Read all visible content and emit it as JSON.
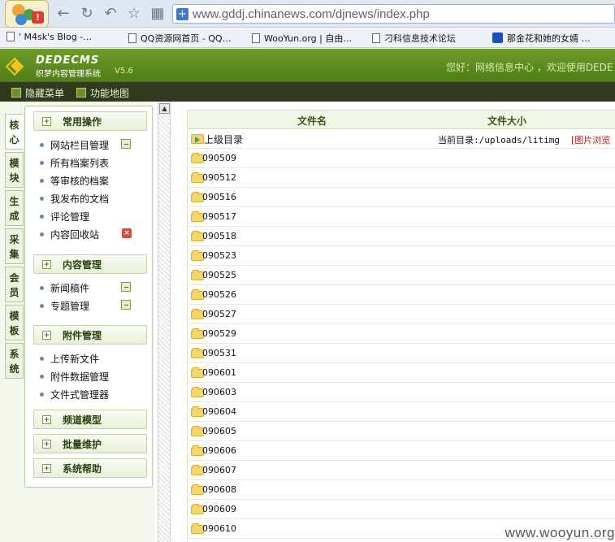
{
  "browser": {
    "url": "www.gddj.chinanews.com/djnews/index.php",
    "bookmarks": [
      {
        "label": "' M4sk's Blog -…"
      },
      {
        "label": "QQ资源网首页 - QQ…"
      },
      {
        "label": "WooYun.org | 自由…"
      },
      {
        "label": "刁科信息技术论坛"
      },
      {
        "label": "那金花和她的女婿 …"
      }
    ]
  },
  "cms": {
    "logo": "DEDECMS",
    "subtitle": "织梦内容管理系统",
    "version": "V5.6",
    "welcome": "您好：网络信息中心 ，欢迎使用DEDE",
    "toolbar": [
      {
        "label": "隐藏菜单"
      },
      {
        "label": "功能地图"
      }
    ]
  },
  "side_tabs": [
    {
      "label": "核心",
      "active": true
    },
    {
      "label": "模块"
    },
    {
      "label": "生成"
    },
    {
      "label": "采集"
    },
    {
      "label": "会员"
    },
    {
      "label": "模板"
    },
    {
      "label": "系统"
    }
  ],
  "menu": {
    "sections": [
      {
        "title": "常用操作",
        "items": [
          {
            "label": "网站栏目管理",
            "icon": "add-icon"
          },
          {
            "label": "所有档案列表"
          },
          {
            "label": "等审核的档案"
          },
          {
            "label": "我发布的文档"
          },
          {
            "label": "评论管理"
          },
          {
            "label": "内容回收站",
            "icon": "shield-icon"
          }
        ]
      },
      {
        "title": "内容管理",
        "items": [
          {
            "label": "新闻稿件",
            "icon": "add-icon"
          },
          {
            "label": "专题管理",
            "icon": "add-icon"
          }
        ]
      },
      {
        "title": "附件管理",
        "items": [
          {
            "label": "上传新文件"
          },
          {
            "label": "附件数据管理"
          },
          {
            "label": "文件式管理器"
          }
        ]
      },
      {
        "title": "频道模型",
        "items": []
      },
      {
        "title": "批量维护",
        "items": []
      },
      {
        "title": "系统帮助",
        "items": []
      }
    ]
  },
  "file_list": {
    "headers": {
      "name": "文件名",
      "size": "文件大小"
    },
    "parent_label": "上级目录",
    "current_dir": "当前目录:/uploads/litimg",
    "image_browse": "[图片浏览",
    "folders": [
      "090509",
      "090512",
      "090516",
      "090517",
      "090518",
      "090523",
      "090525",
      "090526",
      "090527",
      "090529",
      "090531",
      "090601",
      "090603",
      "090604",
      "090605",
      "090606",
      "090607",
      "090608",
      "090609",
      "090610"
    ]
  },
  "watermark": "www.wooyun.org"
}
